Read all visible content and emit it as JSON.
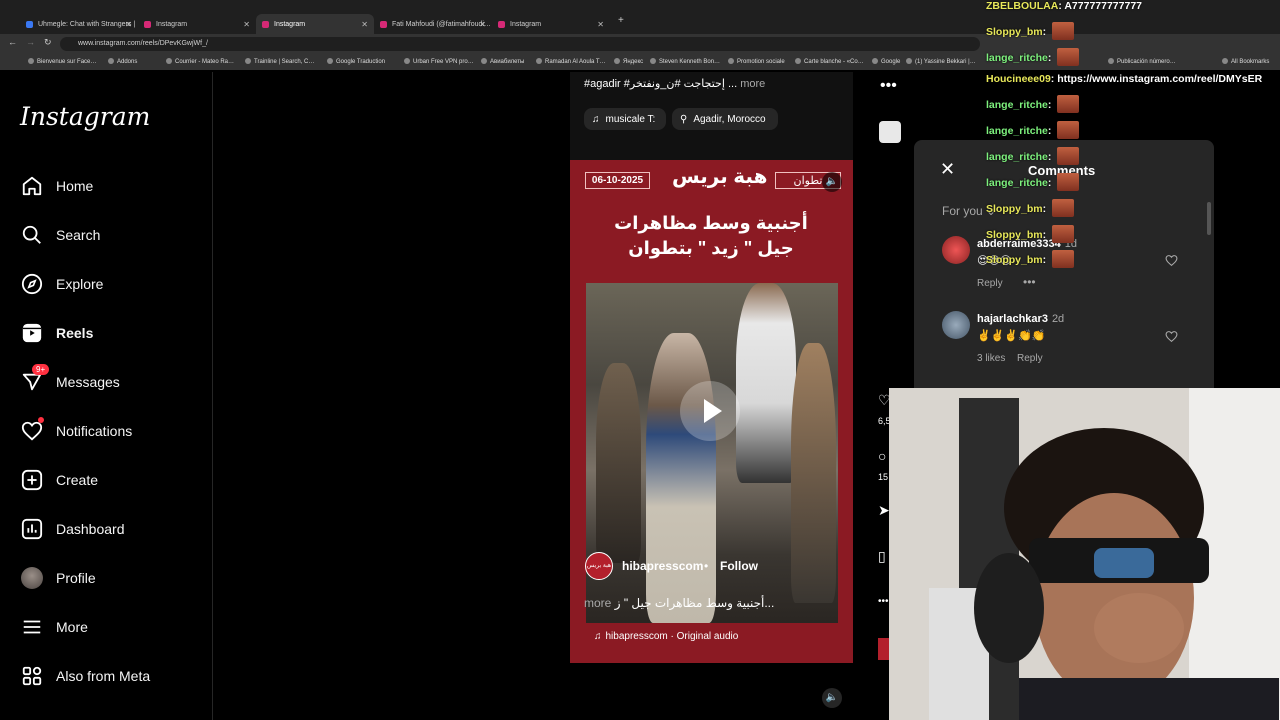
{
  "browser": {
    "tabs": [
      {
        "label": "Uhmegle: Chat with Strangers |",
        "active": false
      },
      {
        "label": "Instagram",
        "active": false
      },
      {
        "label": "Instagram",
        "active": true
      },
      {
        "label": "Fati Mahfoudi (@fatimahfoudi…",
        "active": false
      },
      {
        "label": "Instagram",
        "active": false
      }
    ],
    "url": "www.instagram.com/reels/DPevKGwjWf_/",
    "bookmarks": [
      "Bienvenue sur Face…",
      "Addons",
      "Courrier - Mateo Ra…",
      "Trainline | Search, C…",
      "Google Traduction",
      "Urban Free VPN pro…",
      "Авиабилеты",
      "Ramadan Al Aoula T…",
      "Яндекс",
      "Steven Kenneth Bon…",
      "Promotion sociale",
      "Carte blanche - «Co…",
      "Google",
      "(1) Yassine Bekkari |…",
      "Publicación número…",
      "All Bookmarks"
    ]
  },
  "sidebar": {
    "logo": "Instagram",
    "items": [
      {
        "label": "Home",
        "icon": "home-icon"
      },
      {
        "label": "Search",
        "icon": "search-icon"
      },
      {
        "label": "Explore",
        "icon": "compass-icon"
      },
      {
        "label": "Reels",
        "icon": "reels-icon"
      },
      {
        "label": "Messages",
        "icon": "messenger-icon",
        "badge": "9+"
      },
      {
        "label": "Notifications",
        "icon": "heart-icon"
      },
      {
        "label": "Create",
        "icon": "plus-square-icon"
      },
      {
        "label": "Dashboard",
        "icon": "dashboard-icon"
      },
      {
        "label": "Profile",
        "icon": "avatar"
      },
      {
        "label": "More",
        "icon": "hamburger-icon"
      },
      {
        "label": "Also from Meta",
        "icon": "meta-apps-icon"
      }
    ]
  },
  "post": {
    "caption": "#agadir #إحتجاجت #ن_ونفتخر ...",
    "caption_more": "more",
    "music_pill": "musicale T:",
    "location_pill": "Agadir, Morocco"
  },
  "reel": {
    "date": "06-10-2025",
    "brand": "هبة بريس",
    "city": "تطوان",
    "headline_line1": "أجنبية وسط مظاهرات",
    "headline_line2": "جيل \" زيد \" بتطوان",
    "account": "hibapresscom",
    "follow_label": "Follow",
    "description": "أجنبية وسط مظاهرات جيل \" ز...",
    "description_more": "more",
    "audio": "hibapresscom · Original audio"
  },
  "rail": {
    "likes": "6,5",
    "comments": "15"
  },
  "comments_panel": {
    "title": "Comments",
    "filter": "For you",
    "comments": [
      {
        "user": "abderraime3334",
        "time": "1d",
        "text": "😍😍😍",
        "likes": "",
        "reply_label": "Reply"
      },
      {
        "user": "hajarlachkar3",
        "time": "2d",
        "text": "✌️✌️✌️👏👏",
        "likes": "3 likes",
        "reply_label": "Reply"
      }
    ]
  },
  "stream_chat": [
    {
      "name": "ZBELBOULAA",
      "text": ": A777777777777"
    },
    {
      "name": "Sloppy_bm",
      "text": ":"
    },
    {
      "name": "lange_ritche",
      "text": ":"
    },
    {
      "name": "Houcineee09",
      "text": ": https://www.instagram.com/reel/DMYsER"
    },
    {
      "name": "lange_ritche",
      "text": ":"
    },
    {
      "name": "lange_ritche",
      "text": ":"
    },
    {
      "name": "lange_ritche",
      "text": ":"
    },
    {
      "name": "lange_ritche",
      "text": ":"
    },
    {
      "name": "Sloppy_bm",
      "text": ":"
    },
    {
      "name": "Sloppy_bm",
      "text": ":"
    },
    {
      "name": "Sloppy_bm",
      "text": ":"
    }
  ],
  "colors": {
    "reel_background": "#8b1a23",
    "notification_red": "#ff3040",
    "panel_background": "#262626"
  }
}
